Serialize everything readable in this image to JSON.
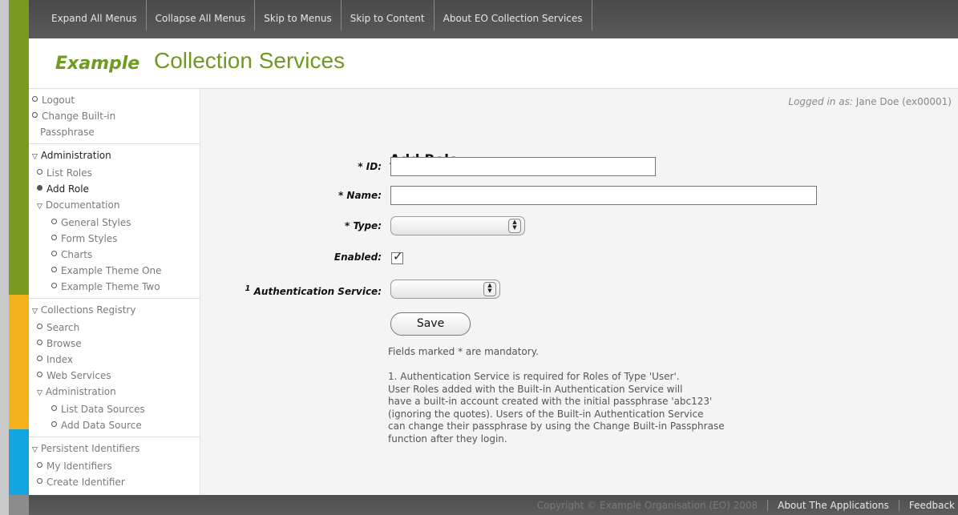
{
  "topnav": [
    "Expand All Menus",
    "Collapse All Menus",
    "Skip to Menus",
    "Skip to Content",
    "About EO Collection Services"
  ],
  "header": {
    "brand_example": "Example",
    "brand_title": "Collection Services"
  },
  "sidebar": {
    "group1": [
      "Logout",
      "Change Built-in",
      "Passphrase"
    ],
    "group2": {
      "heading": "Administration",
      "list_roles": "List Roles",
      "add_role": "Add Role",
      "documentation": "Documentation",
      "doc_items": [
        "General Styles",
        "Form Styles",
        "Charts",
        "Example Theme One",
        "Example Theme Two"
      ]
    },
    "group3": {
      "heading": "Collections Registry",
      "items": [
        "Search",
        "Browse",
        "Index",
        "Web Services"
      ],
      "administration": "Administration",
      "admin_items": [
        "List Data Sources",
        "Add Data Source"
      ]
    },
    "group4": {
      "heading": "Persistent Identifiers",
      "items": [
        "My Identifiers",
        "Create Identifier"
      ]
    }
  },
  "content": {
    "logged_in_label": "Logged in as:",
    "logged_in_user": "Jane Doe (ex00001)",
    "title": "Add Role",
    "fields": {
      "id_label": "* ID:",
      "id_value": "",
      "name_label": "* Name:",
      "name_value": "",
      "type_label": "* Type:",
      "type_value": "",
      "enabled_label": "Enabled:",
      "enabled_checked": true,
      "auth_label_sup": "1",
      "auth_label": "Authentication Service:",
      "auth_value": ""
    },
    "save_label": "Save",
    "mandatory_note": "Fields marked * are mandatory.",
    "footnote_lines": [
      "1. Authentication Service is required for Roles of Type 'User'.",
      "User Roles added with the Built-in Authentication Service will",
      "have a built-in account created with the initial passphrase 'abc123'",
      "(ignoring the quotes). Users of the Built-in Authentication Service",
      "can change their passphrase by using the Change Built-in Passphrase",
      "function after they login."
    ]
  },
  "footer": {
    "copyright": "Copyright © Example Organisation (EO) 2008",
    "links": [
      "About The Applications",
      "Feedback"
    ]
  },
  "colors": {
    "brand_green": "#6e9a1e",
    "stripe_green": "#7a9a1f",
    "stripe_yellow": "#f4b21a",
    "stripe_blue": "#12a5df",
    "nav_bar": "#4a4a4a"
  }
}
